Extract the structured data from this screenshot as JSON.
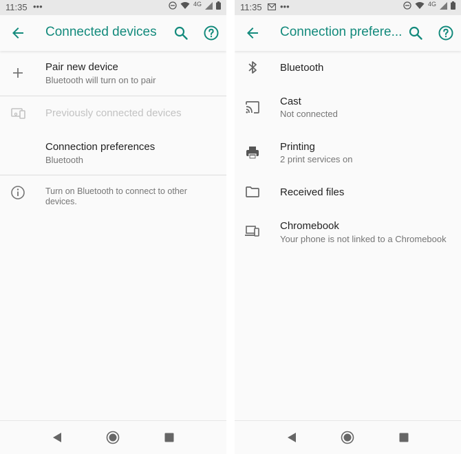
{
  "left_screen": {
    "status": {
      "time": "11:35",
      "extra": "•••",
      "network": "4G"
    },
    "toolbar": {
      "title": "Connected devices"
    },
    "rows": [
      {
        "title": "Pair new device",
        "subtitle": "Bluetooth will turn on to pair"
      },
      {
        "title": "Previously connected devices"
      },
      {
        "title": "Connection preferences",
        "subtitle": "Bluetooth"
      }
    ],
    "footer_info": {
      "line1": "Turn on Bluetooth to connect to other",
      "line2": "devices."
    }
  },
  "right_screen": {
    "status": {
      "time": "11:35",
      "extra": "•••",
      "network": "4G"
    },
    "toolbar": {
      "title": "Connection prefere..."
    },
    "items": [
      {
        "title": "Bluetooth",
        "icon": "bluetooth-icon"
      },
      {
        "title": "Cast",
        "subtitle": "Not connected",
        "icon": "cast-icon"
      },
      {
        "title": "Printing",
        "subtitle": "2 print services on",
        "icon": "printer-icon"
      },
      {
        "title": "Received files",
        "icon": "folder-icon"
      },
      {
        "title": "Chromebook",
        "subtitle": "Your phone is not linked to a Chromebook",
        "icon": "chromebook-icon"
      }
    ]
  },
  "colors": {
    "accent": "#138a7c",
    "text_primary": "#222222",
    "text_secondary": "#757575",
    "disabled": "#c2c2c2"
  }
}
